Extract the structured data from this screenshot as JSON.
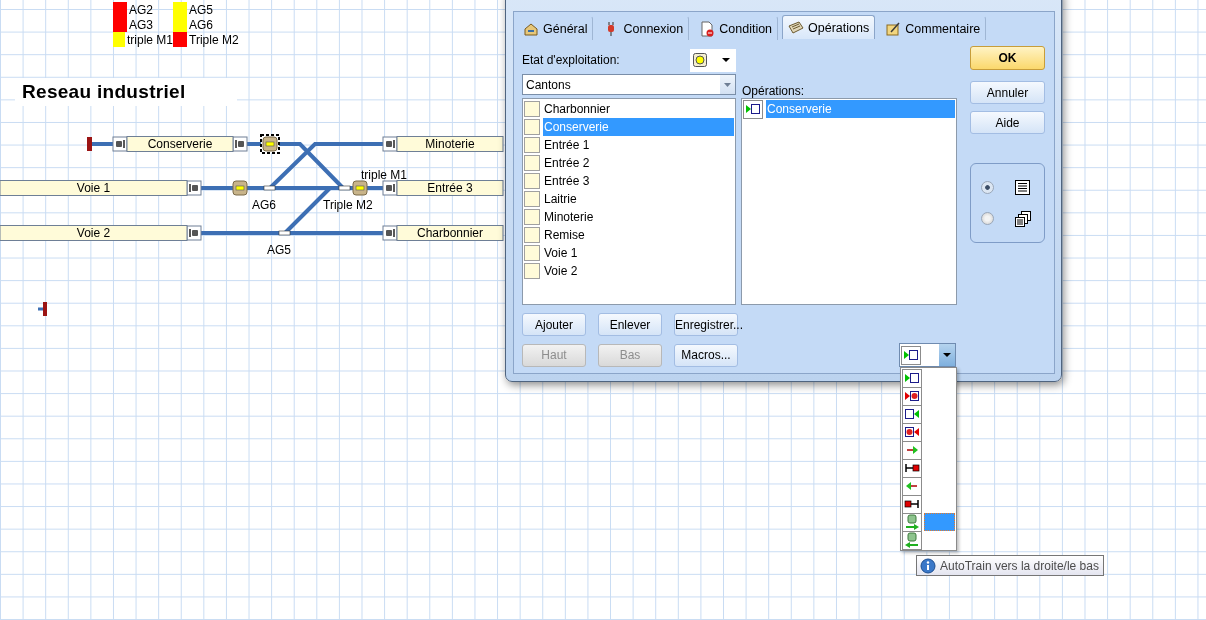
{
  "legend": [
    {
      "label": "AG2",
      "color": "#ff0000"
    },
    {
      "label": "AG5",
      "color": "#ffff00"
    },
    {
      "label": "AG3",
      "color": "#ff0000"
    },
    {
      "label": "AG6",
      "color": "#ffff00"
    },
    {
      "label": "triple M1",
      "color": "#ffff00"
    },
    {
      "label": "Triple M2",
      "color": "#ff0000"
    }
  ],
  "canvas_title": "Reseau industriel",
  "diagram": {
    "blocks": [
      "Conserverie",
      "Minoterie",
      "Voie 1",
      "Entrée 3",
      "Voie 2",
      "Charbonnier"
    ],
    "turnout_labels": [
      "triple M1",
      "AG6",
      "Triple M2",
      "AG5"
    ]
  },
  "dialog": {
    "tabs": [
      {
        "label": "Général",
        "selected": false
      },
      {
        "label": "Connexion",
        "selected": false
      },
      {
        "label": "Condition",
        "selected": false
      },
      {
        "label": "Opérations",
        "selected": true
      },
      {
        "label": "Commentaire",
        "selected": false
      }
    ],
    "state_label": "Etat d'exploitation:",
    "category": "Cantons",
    "operations_label": "Opérations:",
    "blocks": [
      {
        "label": "Charbonnier",
        "selected": false
      },
      {
        "label": "Conserverie",
        "selected": true
      },
      {
        "label": "Entrée 1",
        "selected": false
      },
      {
        "label": "Entrée 2",
        "selected": false
      },
      {
        "label": "Entrée 3",
        "selected": false
      },
      {
        "label": "Laitrie",
        "selected": false
      },
      {
        "label": "Minoterie",
        "selected": false
      },
      {
        "label": "Remise",
        "selected": false
      },
      {
        "label": "Voie 1",
        "selected": false
      },
      {
        "label": "Voie 2",
        "selected": false
      }
    ],
    "operations": [
      {
        "label": "Conserverie",
        "kind": "enter-right",
        "selected": true
      }
    ],
    "list_buttons": [
      {
        "label": "Ajouter",
        "disabled": false
      },
      {
        "label": "Enlever",
        "disabled": false
      },
      {
        "label": "Enregistrer...",
        "disabled": false
      },
      {
        "label": "Haut",
        "disabled": true
      },
      {
        "label": "Bas",
        "disabled": true
      },
      {
        "label": "Macros...",
        "disabled": false
      }
    ],
    "buttons": [
      {
        "label": "OK",
        "kind": "default"
      },
      {
        "label": "Annuler",
        "kind": "normal"
      },
      {
        "label": "Aide",
        "kind": "normal"
      }
    ],
    "view_options": [
      {
        "kind": "list",
        "selected": true
      },
      {
        "kind": "cascade",
        "selected": false
      }
    ],
    "operation_dropdown": {
      "kind": "enter-right"
    }
  },
  "operation_menu": [
    {
      "kind": "enter-right",
      "selected": false
    },
    {
      "kind": "enter-right-blocked",
      "selected": false
    },
    {
      "kind": "enter-left",
      "selected": false
    },
    {
      "kind": "enter-left-blocked",
      "selected": false
    },
    {
      "kind": "arrow-right",
      "selected": false
    },
    {
      "kind": "stop-right",
      "selected": false
    },
    {
      "kind": "arrow-left",
      "selected": false
    },
    {
      "kind": "stop-left",
      "selected": false
    },
    {
      "kind": "autotrain-right",
      "selected": true
    },
    {
      "kind": "autotrain-left",
      "selected": false
    }
  ],
  "tooltip": "AutoTrain vers la droite/le bas"
}
